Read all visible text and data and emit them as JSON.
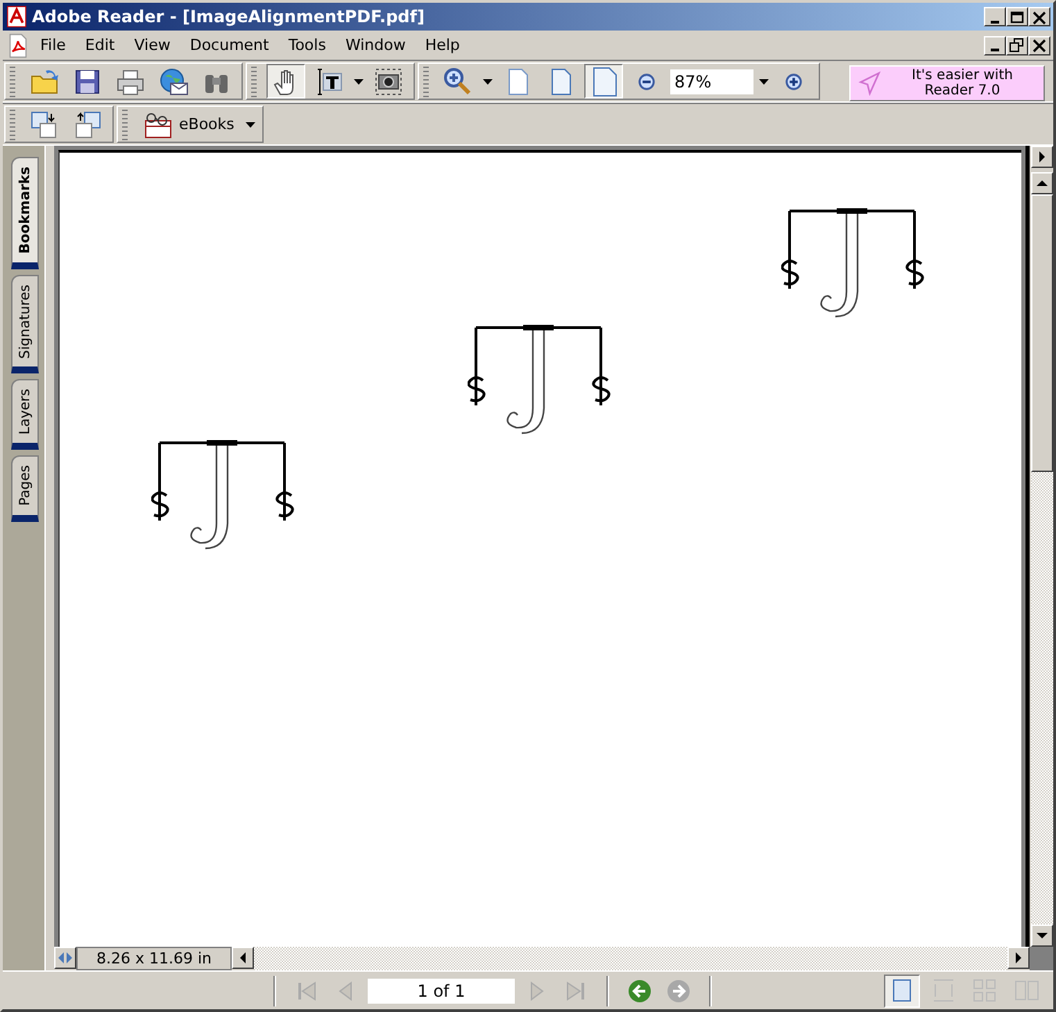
{
  "window": {
    "title": "Adobe Reader - [ImageAlignmentPDF.pdf]"
  },
  "menu": [
    "File",
    "Edit",
    "View",
    "Document",
    "Tools",
    "Window",
    "Help"
  ],
  "tool_buttons": [
    {
      "selected": false
    },
    {
      "selected": false
    },
    {
      "selected": false
    },
    {
      "selected": false
    },
    {
      "selected": false
    },
    {
      "selected": true
    },
    {
      "selected": false
    },
    {
      "selected": false
    },
    {
      "selected": false
    },
    {
      "selected": false
    },
    {
      "selected": false
    },
    {
      "selected": true
    }
  ],
  "zoom": {
    "value": "87%"
  },
  "promo": {
    "lines": [
      "It's easier with",
      "Reader 7.0"
    ]
  },
  "ebooks": {
    "label": "eBooks"
  },
  "side_tabs": [
    {
      "label": "Bookmarks",
      "selected": true
    },
    {
      "label": "Signatures",
      "selected": false
    },
    {
      "label": "Layers",
      "selected": false
    },
    {
      "label": "Pages",
      "selected": false
    }
  ],
  "page_size": "8.26 x 11.69 in",
  "page_field": {
    "value": "1 of 1"
  },
  "view_buttons": [
    {
      "selected": true
    },
    {
      "selected": false
    },
    {
      "selected": false
    },
    {
      "selected": false
    }
  ]
}
